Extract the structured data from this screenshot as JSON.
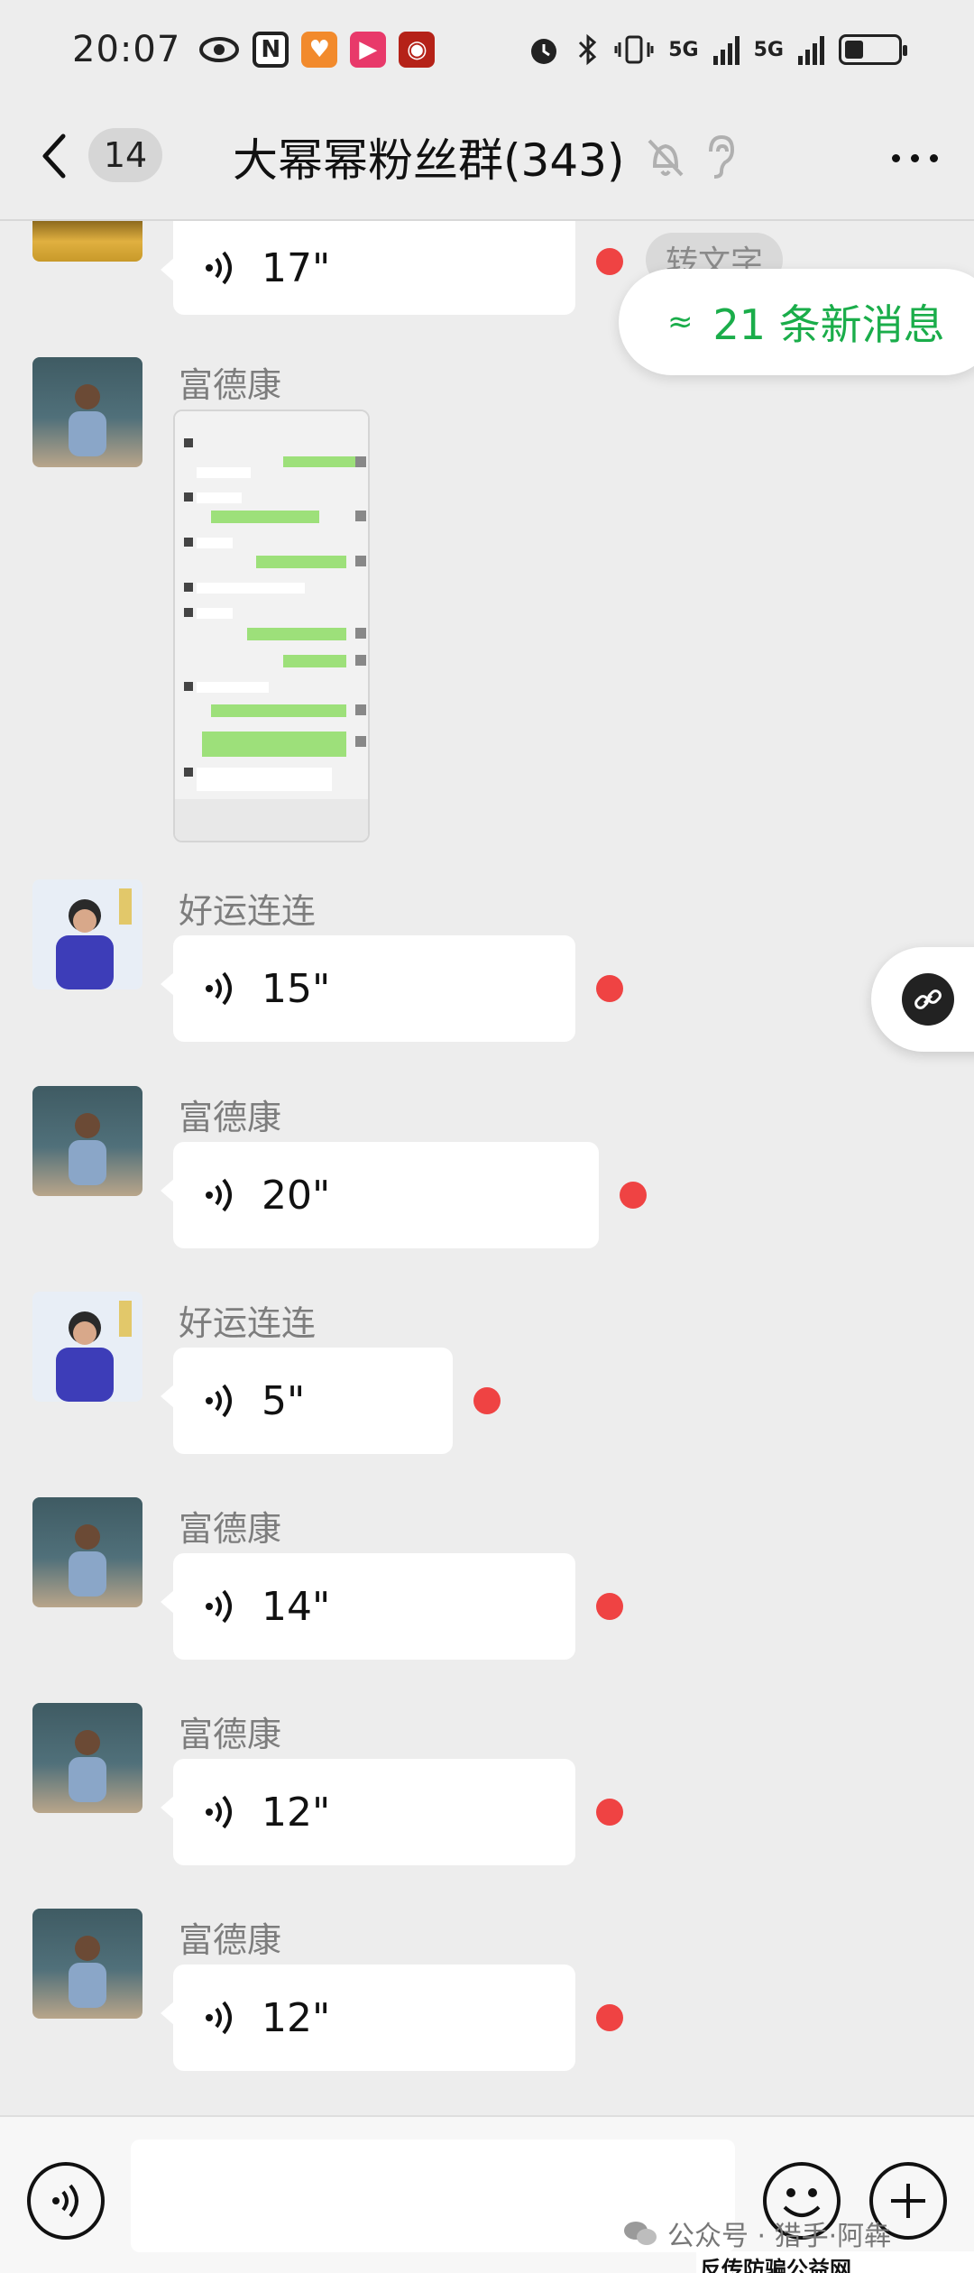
{
  "status_bar": {
    "time": "20:07",
    "network_1": "5G",
    "network_2": "5G",
    "battery_level": 0.35
  },
  "header": {
    "back_count": "14",
    "title": "大幂幂粉丝群(343)"
  },
  "new_messages": "21 条新消息",
  "transcribe_label": "转文字",
  "messages": [
    {
      "sender": "",
      "duration": "17\"",
      "unread": true,
      "avatar": "gold-figure"
    },
    {
      "sender": "富德康",
      "type": "image"
    },
    {
      "sender": "好运连连",
      "duration": "15\"",
      "unread": true
    },
    {
      "sender": "富德康",
      "duration": "20\"",
      "unread": true
    },
    {
      "sender": "好运连连",
      "duration": "5\"",
      "unread": true
    },
    {
      "sender": "富德康",
      "duration": "14\"",
      "unread": true
    },
    {
      "sender": "富德康",
      "duration": "12\"",
      "unread": true
    },
    {
      "sender": "富德康",
      "duration": "12\"",
      "unread": true
    }
  ],
  "input": {
    "placeholder": ""
  },
  "watermark": {
    "account": "公众号 · 猎手·阿犇",
    "site": "反传防骗公益网 www.wazi.cc"
  },
  "colors": {
    "background": "#ededed",
    "accent_green": "#1aad4a",
    "unread_red": "#ef4343",
    "bubble": "#ffffff"
  }
}
